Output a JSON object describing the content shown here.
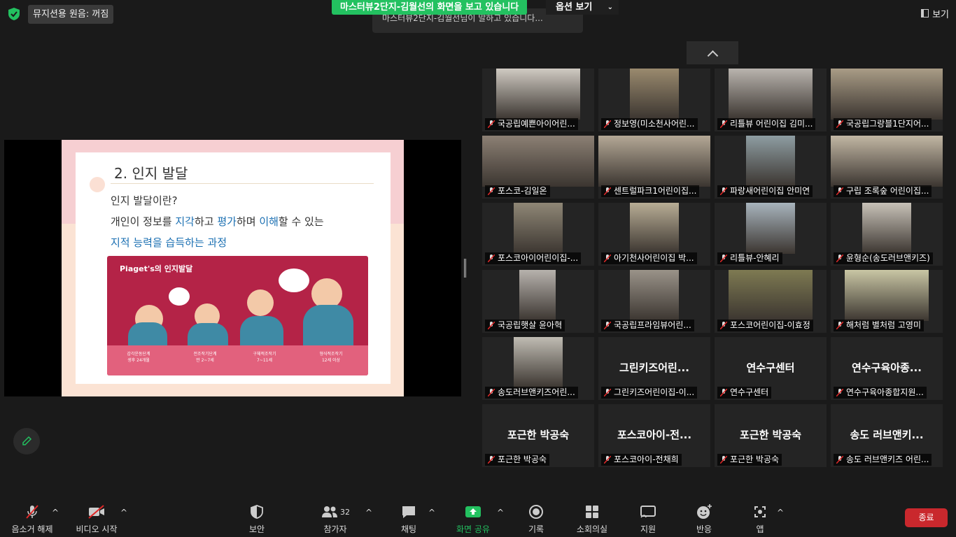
{
  "topbar": {
    "music_status": "뮤지션용 원음: 꺼짐",
    "banner": "마스터뷰2단지-김월선의 화면을 보고 있습니다",
    "options": "옵션 보기",
    "tooltip": "마스터뷰2단지-김월선님이 말하고 있습니다...",
    "view": "보기"
  },
  "slide": {
    "title": "2. 인지 발달",
    "line1": "인지 발달이란?",
    "line2_a": "개인이 정보를 ",
    "line2_b": "지각",
    "line2_c": "하고 ",
    "line2_d": "평가",
    "line2_e": "하며 ",
    "line2_f": "이해",
    "line2_g": "할 수 있는",
    "line3": "지적 능력을 습득하는 과정",
    "image_title": "Piaget's의 인지발달",
    "stages": [
      "감각운동단계",
      "전조작기단계",
      "구체적조작기",
      "형식적조작기"
    ],
    "stage_ages": [
      "생후 24개월",
      "만 2~7세",
      "7~11세",
      "12세 이상"
    ]
  },
  "participants": [
    {
      "name": "국공립예쁜아이어린...",
      "video": true
    },
    {
      "name": "정보영(미소천사어린...",
      "video": true
    },
    {
      "name": "리틀뷰 어린이집 김미...",
      "video": true
    },
    {
      "name": "국공립그랑블1단지어...",
      "video": true
    },
    {
      "name": "포스코-김일온",
      "video": true
    },
    {
      "name": "센트럴파크1어린이집...",
      "video": true
    },
    {
      "name": "파랑새어린이집 안미연",
      "video": true
    },
    {
      "name": "구립 조록숲 어린이집...",
      "video": true
    },
    {
      "name": "포스코아이어린이집-...",
      "video": true
    },
    {
      "name": "아기천사어린이집 박...",
      "video": true
    },
    {
      "name": "리틀뷰-안혜리",
      "video": true
    },
    {
      "name": "윤형순(송도러브앤키즈)",
      "video": true
    },
    {
      "name": "국공립햇살 윤아혁",
      "video": true
    },
    {
      "name": "국공립프라임뷰어린...",
      "video": true
    },
    {
      "name": "포스코어린이집-이효정",
      "video": true
    },
    {
      "name": "해처럼 별처럼 고영미",
      "video": true
    },
    {
      "name": "송도러브앤키즈어린...",
      "video": true
    },
    {
      "name": "그린키즈어린이집-이...",
      "video": false,
      "big": "그린키즈어린..."
    },
    {
      "name": "연수구센터",
      "video": false,
      "big": "연수구센터"
    },
    {
      "name": "연수구육아종합지원...",
      "video": false,
      "big": "연수구육아종..."
    },
    {
      "name": "포근한 박공숙",
      "video": false,
      "big": "포근한 박공숙"
    },
    {
      "name": "포스코아이-전채희",
      "video": false,
      "big": "포스코아이-전..."
    },
    {
      "name": "포근한 박공숙",
      "video": false,
      "big": "포근한 박공숙"
    },
    {
      "name": "송도 러브앤키즈 어린...",
      "video": false,
      "big": "송도 러브앤키..."
    }
  ],
  "toolbar": {
    "unmute": "음소거 해제",
    "video": "비디오 시작",
    "security": "보안",
    "participants": "참가자",
    "participant_count": "32",
    "chat": "채팅",
    "share": "화면 공유",
    "record": "기록",
    "breakout": "소회의실",
    "support": "지원",
    "reactions": "반응",
    "apps": "앱",
    "end": "종료"
  },
  "colors": {
    "banner_green": "#23c160",
    "end_red": "#c9282d",
    "share_green": "#23c160"
  }
}
